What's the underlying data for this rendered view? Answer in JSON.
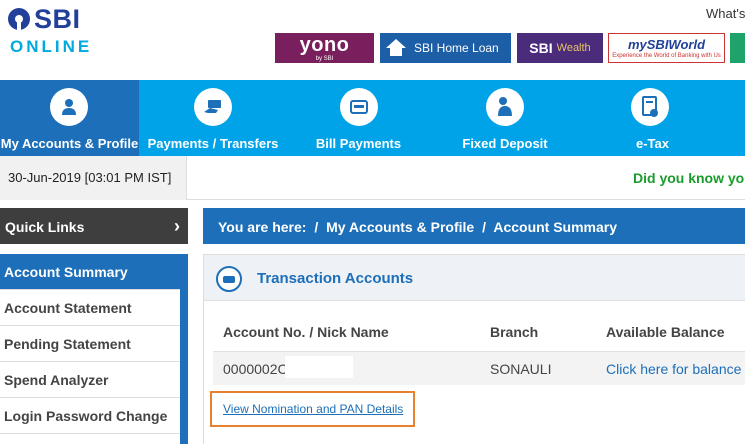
{
  "header": {
    "logo_sbi": "SBI",
    "logo_online": "ONLINE",
    "whats_new": "What's",
    "promos": {
      "yono": "yono",
      "yono_sub": "by SBI",
      "home_loan": "SBI Home Loan",
      "wealth_sbi": "SBI",
      "wealth_label": "Wealth",
      "world": "mySBIWorld",
      "world_sub": "Experience the World of Banking with Us"
    }
  },
  "nav": {
    "items": [
      {
        "label": "My Accounts & Profile",
        "icon": "user-icon"
      },
      {
        "label": "Payments / Transfers",
        "icon": "money-hand-icon"
      },
      {
        "label": "Bill Payments",
        "icon": "bill-icon"
      },
      {
        "label": "Fixed Deposit",
        "icon": "money-bag-icon"
      },
      {
        "label": "e-Tax",
        "icon": "tax-document-icon"
      }
    ]
  },
  "datebar": {
    "datetime": "30-Jun-2019 [03:01 PM IST]",
    "did_you_know": "Did you know you"
  },
  "sidebar": {
    "quick_links": "Quick Links",
    "items": [
      "Account Summary",
      "Account Statement",
      "Pending Statement",
      "Spend Analyzer",
      "Login Password Change"
    ]
  },
  "main": {
    "breadcrumb": {
      "prefix": "You are here:",
      "sep": "/",
      "level1": "My Accounts & Profile",
      "level2": "Account Summary"
    },
    "section_title": "Transaction Accounts",
    "table": {
      "headers": [
        "Account No. / Nick Name",
        "Branch",
        "Available Balance"
      ],
      "rows": [
        {
          "account": "0000002C",
          "branch": "SONAULI",
          "balance_link": "Click here for balance"
        }
      ]
    },
    "nomination_link": "View Nomination and PAN Details"
  },
  "colors": {
    "brand_blue": "#1c6fb8",
    "nav_blue": "#00a3e8",
    "highlight_orange": "#e8812f",
    "green_text": "#1a9c2c"
  }
}
